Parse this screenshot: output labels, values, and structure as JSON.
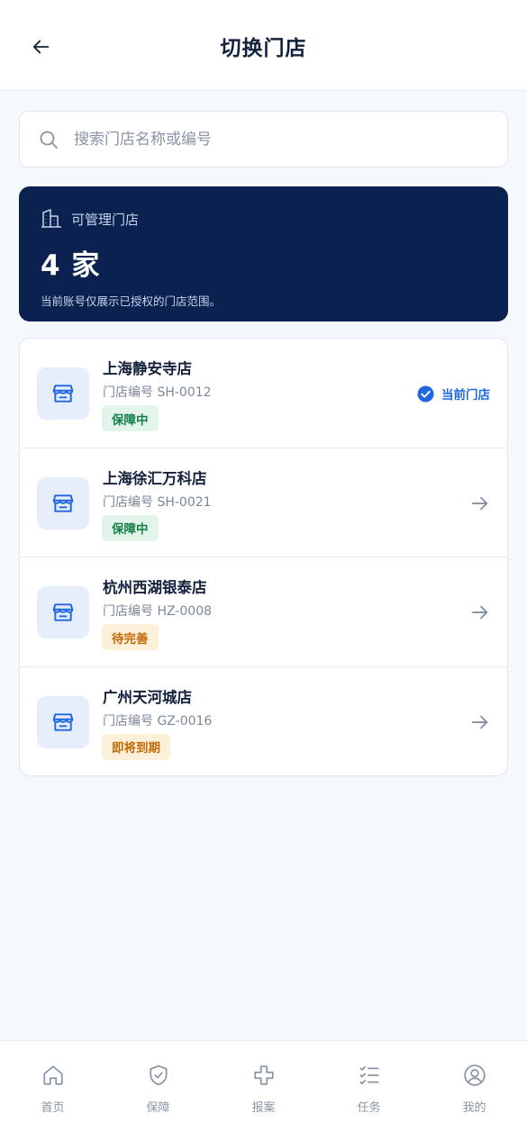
{
  "header": {
    "title": "切换门店",
    "back_icon": "arrow-left-icon"
  },
  "search": {
    "placeholder": "搜索门店名称或编号",
    "value": ""
  },
  "summary": {
    "label": "可管理门店",
    "count": "4 家",
    "note": "当前账号仅展示已授权的门店范围。"
  },
  "stores": [
    {
      "name": "上海静安寺店",
      "code": "门店编号 SH-0012",
      "status": "保障中",
      "status_color": "green",
      "current_label": "当前门店",
      "is_current": true
    },
    {
      "name": "上海徐汇万科店",
      "code": "门店编号 SH-0021",
      "status": "保障中",
      "status_color": "green",
      "is_current": false
    },
    {
      "name": "杭州西湖银泰店",
      "code": "门店编号 HZ-0008",
      "status": "待完善",
      "status_color": "orange",
      "is_current": false
    },
    {
      "name": "广州天河城店",
      "code": "门店编号 GZ-0016",
      "status": "即将到期",
      "status_color": "orange",
      "is_current": false
    }
  ],
  "tabbar": {
    "items": [
      {
        "label": "首页",
        "icon": "home-icon"
      },
      {
        "label": "保障",
        "icon": "shield-icon"
      },
      {
        "label": "报案",
        "icon": "plus-cross-icon"
      },
      {
        "label": "任务",
        "icon": "checklist-icon"
      },
      {
        "label": "我的",
        "icon": "user-circle-icon"
      }
    ]
  },
  "colors": {
    "accent": "#1f66e0",
    "summary_bg": "#0b2150",
    "badge_green_bg": "#e3f5ea",
    "badge_green_text": "#15804a",
    "badge_orange_bg": "#fdf0d9",
    "badge_orange_text": "#c16a08"
  }
}
